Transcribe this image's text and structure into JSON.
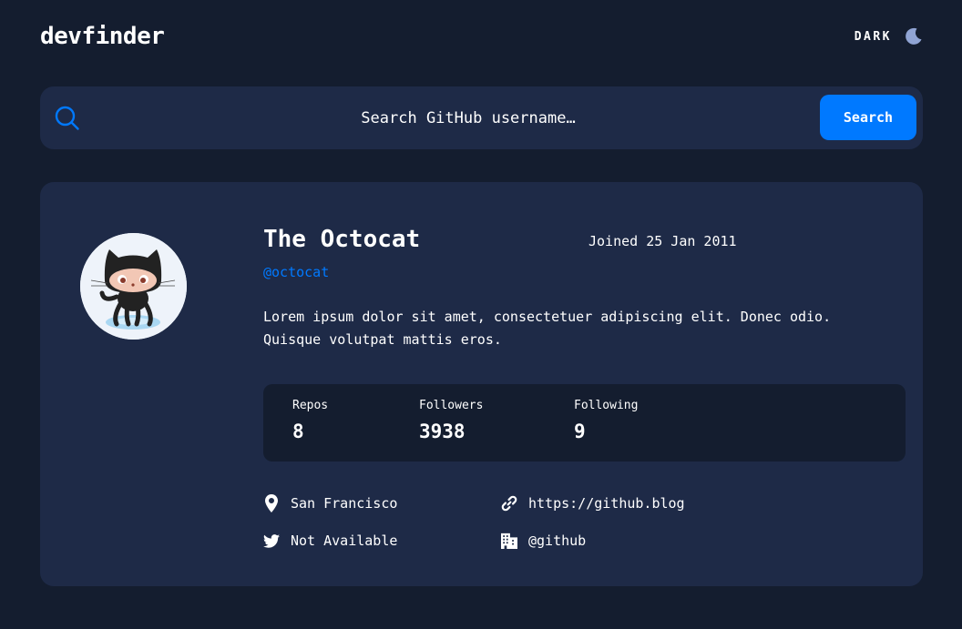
{
  "header": {
    "logo": "devfinder",
    "theme_label": "DARK",
    "theme_icon": "moon-icon"
  },
  "search": {
    "placeholder": "Search GitHub username…",
    "value": "",
    "button_label": "Search",
    "icon": "search-icon"
  },
  "profile": {
    "name": "The Octocat",
    "login": "@octocat",
    "joined": "Joined 25 Jan 2011",
    "bio": "Lorem ipsum dolor sit amet, consectetuer adipiscing elit. Donec odio. Quisque volutpat mattis eros.",
    "avatar": "octocat-avatar"
  },
  "stats": [
    {
      "label": "Repos",
      "value": "8"
    },
    {
      "label": "Followers",
      "value": "3938"
    },
    {
      "label": "Following",
      "value": "9"
    }
  ],
  "info": {
    "location": {
      "icon": "location-pin-icon",
      "text": "San Francisco"
    },
    "blog": {
      "icon": "link-icon",
      "text": "https://github.blog"
    },
    "twitter": {
      "icon": "twitter-icon",
      "text": "Not Available"
    },
    "company": {
      "icon": "building-icon",
      "text": "@github"
    }
  },
  "colors": {
    "background": "#141d2f",
    "card": "#1e2a47",
    "accent": "#0079ff",
    "text": "#ffffff"
  }
}
